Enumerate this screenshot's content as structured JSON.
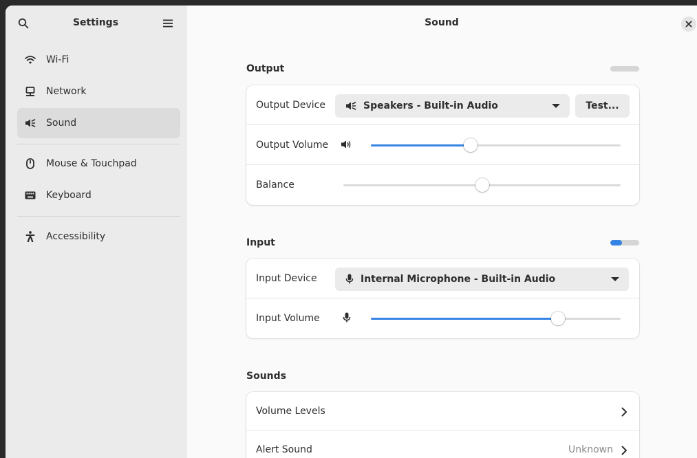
{
  "sidebar": {
    "title": "Settings",
    "items": [
      {
        "label": "Wi-Fi",
        "icon": "wifi-icon"
      },
      {
        "label": "Network",
        "icon": "network-icon"
      },
      {
        "label": "Sound",
        "icon": "sound-icon",
        "active": true
      },
      {
        "label": "Mouse & Touchpad",
        "icon": "mouse-icon"
      },
      {
        "label": "Keyboard",
        "icon": "keyboard-icon"
      },
      {
        "label": "Accessibility",
        "icon": "accessibility-icon"
      }
    ]
  },
  "main": {
    "title": "Sound",
    "output": {
      "title": "Output",
      "level": 0,
      "device_label": "Output Device",
      "device_value": "Speakers - Built-in Audio",
      "test_label": "Test...",
      "volume_label": "Output Volume",
      "volume": 0.4,
      "balance_label": "Balance",
      "balance": 0.5
    },
    "input": {
      "title": "Input",
      "level": 0.4,
      "device_label": "Input Device",
      "device_value": "Internal Microphone - Built-in Audio",
      "volume_label": "Input Volume",
      "volume": 0.75
    },
    "sounds": {
      "title": "Sounds",
      "volume_levels_label": "Volume Levels",
      "alert_sound_label": "Alert Sound",
      "alert_sound_value": "Unknown"
    }
  },
  "colors": {
    "accent": "#3584e4",
    "sidebar_bg": "#ebebeb",
    "content_bg": "#fafafa"
  }
}
